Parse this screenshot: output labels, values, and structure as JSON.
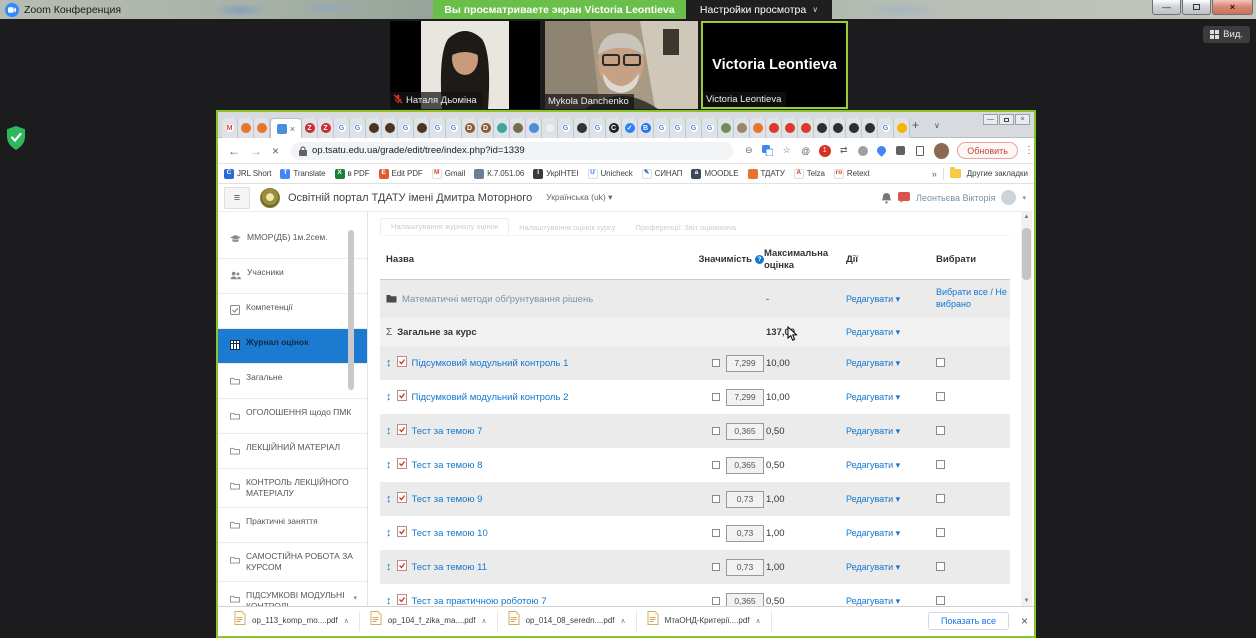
{
  "zoom": {
    "window_title": "Zoom Конференция",
    "banner": "Вы просматриваете экран Victoria Leontieva",
    "view_settings": "Настройки просмотра",
    "view_button": "Вид.",
    "accent_green": "#6abe4a",
    "share_border_green": "#8bc32a"
  },
  "participants": [
    {
      "name": "Наталя Дьоміна",
      "muted": true,
      "active": false,
      "photo": "woman"
    },
    {
      "name": "Mykola Danchenko",
      "muted": false,
      "active": false,
      "photo": "man"
    },
    {
      "name": "Victoria Leontieva",
      "muted": false,
      "active": true,
      "photo": "none",
      "center_label": "Victoria Leontieva"
    }
  ],
  "browser": {
    "url": "op.tsatu.edu.ua/grade/edit/tree/index.php?id=1339",
    "reload_label": "Обновить",
    "other_bookmarks": "Другие закладки",
    "tabs": [
      {
        "c": "#ffffff",
        "g": "M",
        "t": "#ea4335"
      },
      {
        "c": "#e8722e",
        "g": "",
        "t": "#fff"
      },
      {
        "c": "#e8722e",
        "g": "",
        "t": "#fff"
      },
      {
        "c": "#cc2b2b",
        "g": "Z",
        "t": "#fff"
      },
      {
        "c": "#cc2b2b",
        "g": "Z",
        "t": "#fff"
      },
      {
        "c": "#ffffff",
        "g": "G",
        "t": "#4285f4"
      },
      {
        "c": "#ffffff",
        "g": "G",
        "t": "#4285f4"
      },
      {
        "c": "#4a3426",
        "g": "",
        "t": "#fff"
      },
      {
        "c": "#4a3426",
        "g": "",
        "t": "#fff"
      },
      {
        "c": "#ffffff",
        "g": "G",
        "t": "#4285f4"
      },
      {
        "c": "#4a3426",
        "g": "",
        "t": "#fff"
      },
      {
        "c": "#ffffff",
        "g": "G",
        "t": "#4285f4"
      },
      {
        "c": "#ffffff",
        "g": "G",
        "t": "#4285f4"
      },
      {
        "c": "#8a5a30",
        "g": "D",
        "t": "#fff"
      },
      {
        "c": "#8a5a30",
        "g": "D",
        "t": "#fff"
      },
      {
        "c": "#3fa3a0",
        "g": "",
        "t": "#fff"
      },
      {
        "c": "#7a6a52",
        "g": "",
        "t": "#fff"
      },
      {
        "c": "#4a90d9",
        "g": "",
        "t": "#fff"
      },
      {
        "c": "#eef1f4",
        "g": "",
        "t": "#999"
      },
      {
        "c": "#ffffff",
        "g": "G",
        "t": "#4285f4"
      },
      {
        "c": "#333333",
        "g": "",
        "t": "#fff"
      },
      {
        "c": "#ffffff",
        "g": "G",
        "t": "#4285f4"
      },
      {
        "c": "#222222",
        "g": "C",
        "t": "#fff"
      },
      {
        "c": "#2d7ff9",
        "g": "✓",
        "t": "#fff"
      },
      {
        "c": "#1a73e8",
        "g": "B",
        "t": "#fff"
      },
      {
        "c": "#ffffff",
        "g": "G",
        "t": "#4285f4"
      },
      {
        "c": "#ffffff",
        "g": "G",
        "t": "#4285f4"
      },
      {
        "c": "#ffffff",
        "g": "G",
        "t": "#4285f4"
      },
      {
        "c": "#ffffff",
        "g": "G",
        "t": "#4285f4"
      },
      {
        "c": "#6b8e5a",
        "g": "",
        "t": "#fff"
      },
      {
        "c": "#9a8570",
        "g": "",
        "t": "#fff"
      },
      {
        "c": "#e8722e",
        "g": "",
        "t": "#fff"
      },
      {
        "c": "#d63b27",
        "g": "",
        "t": "#fff"
      },
      {
        "c": "#d63b27",
        "g": "",
        "t": "#fff"
      },
      {
        "c": "#d63b27",
        "g": "",
        "t": "#fff"
      },
      {
        "c": "#2e2e2e",
        "g": "",
        "t": "#fff"
      },
      {
        "c": "#2e2e2e",
        "g": "",
        "t": "#fff"
      },
      {
        "c": "#2e2e2e",
        "g": "",
        "t": "#fff"
      },
      {
        "c": "#2e2e2e",
        "g": "",
        "t": "#fff"
      },
      {
        "c": "#ffffff",
        "g": "G",
        "t": "#4285f4"
      },
      {
        "c": "#f4b400",
        "g": "",
        "t": "#fff"
      }
    ],
    "bookmarks": [
      {
        "label": "JRL Short",
        "c": "#2b6cd4",
        "g": "C",
        "t": "#fff"
      },
      {
        "label": "Translate",
        "c": "#4285f4",
        "g": "T",
        "t": "#fff"
      },
      {
        "label": "в PDF",
        "c": "#1e7e34",
        "g": "X",
        "t": "#fff"
      },
      {
        "label": "Edit PDF",
        "c": "#e05a33",
        "g": "E",
        "t": "#fff"
      },
      {
        "label": "Gmail",
        "c": "#ffffff",
        "g": "M",
        "t": "#ea4335"
      },
      {
        "label": "К.7.051.06",
        "c": "#6b7f99",
        "g": "",
        "t": "#fff"
      },
      {
        "label": "УкрІНТЕІ",
        "c": "#3b3b3b",
        "g": "I",
        "t": "#fff"
      },
      {
        "label": "Unicheck",
        "c": "#ffffff",
        "g": "U",
        "t": "#2d7ff9"
      },
      {
        "label": "СИНАП",
        "c": "#ffffff",
        "g": "✎",
        "t": "#2b6cd4"
      },
      {
        "label": "MOODLE",
        "c": "#3a4a5a",
        "g": "a",
        "t": "#fff"
      },
      {
        "label": "ТДАТУ",
        "c": "#e8722e",
        "g": "",
        "t": "#fff"
      },
      {
        "label": "Telza",
        "c": "#ffffff",
        "g": "A",
        "t": "#d93025"
      },
      {
        "label": "Retext",
        "c": "#ffffff",
        "g": "ro",
        "t": "#d93025"
      }
    ]
  },
  "moodle": {
    "site_title": "Освітній портал ТДАТУ імені Дмитра Моторного",
    "language": "Українська (uk)",
    "user_name": "Леонтьєва Вікторія",
    "accent": "#1177d1",
    "ghost_tabs": [
      "Налаштування журналу оцінок",
      "Налаштування оцінок курсу",
      "Преференції: Звіт оцінювача"
    ],
    "sidebar": [
      {
        "label": "ММОР(ДБ) 1м.2сем.",
        "icon": "cap",
        "active": false
      },
      {
        "label": "Учасники",
        "icon": "users",
        "active": false
      },
      {
        "label": "Компетенції",
        "icon": "check",
        "active": false
      },
      {
        "label": "Журнал оцінок",
        "icon": "table",
        "active": true
      },
      {
        "label": "Загальне",
        "icon": "folder",
        "active": false
      },
      {
        "label": "ОГОЛОШЕННЯ щодо ПМК",
        "icon": "folder",
        "active": false
      },
      {
        "label": "ЛЕКЦІЙНИЙ МАТЕРІАЛ",
        "icon": "folder",
        "active": false
      },
      {
        "label": "КОНТРОЛЬ ЛЕКЦІЙНОГО МАТЕРІАЛУ",
        "icon": "folder",
        "active": false
      },
      {
        "label": "Практичні заняття",
        "icon": "folder",
        "active": false
      },
      {
        "label": "САМОСТІЙНА РОБОТА ЗА КУРСОМ",
        "icon": "folder",
        "active": false
      },
      {
        "label": "ПІДСУМКОВІ МОДУЛЬНІ КОНТРОЛІ",
        "icon": "folder",
        "active": false
      }
    ],
    "table": {
      "headers": {
        "name": "Назва",
        "weight": "Значимість",
        "max": "Максимальна оцінка",
        "actions": "Дії",
        "select": "Вибрати"
      },
      "category": {
        "name": "Математичні методи обґрунтування рішень",
        "max": "-",
        "action": "Редагувати",
        "select": "Вибрати все / Не вибрано"
      },
      "total": {
        "name": "Загальне за курс",
        "max": "137,00",
        "action": "Редагувати"
      },
      "action_label": "Редагувати",
      "rows": [
        {
          "name": "Підсумковий модульний контроль 1",
          "weight": "7,299",
          "max": "10,00"
        },
        {
          "name": "Підсумковий модульний контроль 2",
          "weight": "7,299",
          "max": "10,00"
        },
        {
          "name": "Тест за темою 7",
          "weight": "0,365",
          "max": "0,50"
        },
        {
          "name": "Тест за темою 8",
          "weight": "0,365",
          "max": "0,50"
        },
        {
          "name": "Тест за темою 9",
          "weight": "0,73",
          "max": "1,00"
        },
        {
          "name": "Тест за темою 10",
          "weight": "0,73",
          "max": "1,00"
        },
        {
          "name": "Тест за темою 11",
          "weight": "0,73",
          "max": "1,00"
        },
        {
          "name": "Тест за практичною роботою 7",
          "weight": "0,365",
          "max": "0,50"
        }
      ]
    }
  },
  "downloads": {
    "files": [
      "op_113_komp_mo....pdf",
      "op_104_f_zika_ma....pdf",
      "op_014_08_seredn....pdf",
      "МтаОНД-Критерії....pdf"
    ],
    "show_all": "Показать все"
  }
}
